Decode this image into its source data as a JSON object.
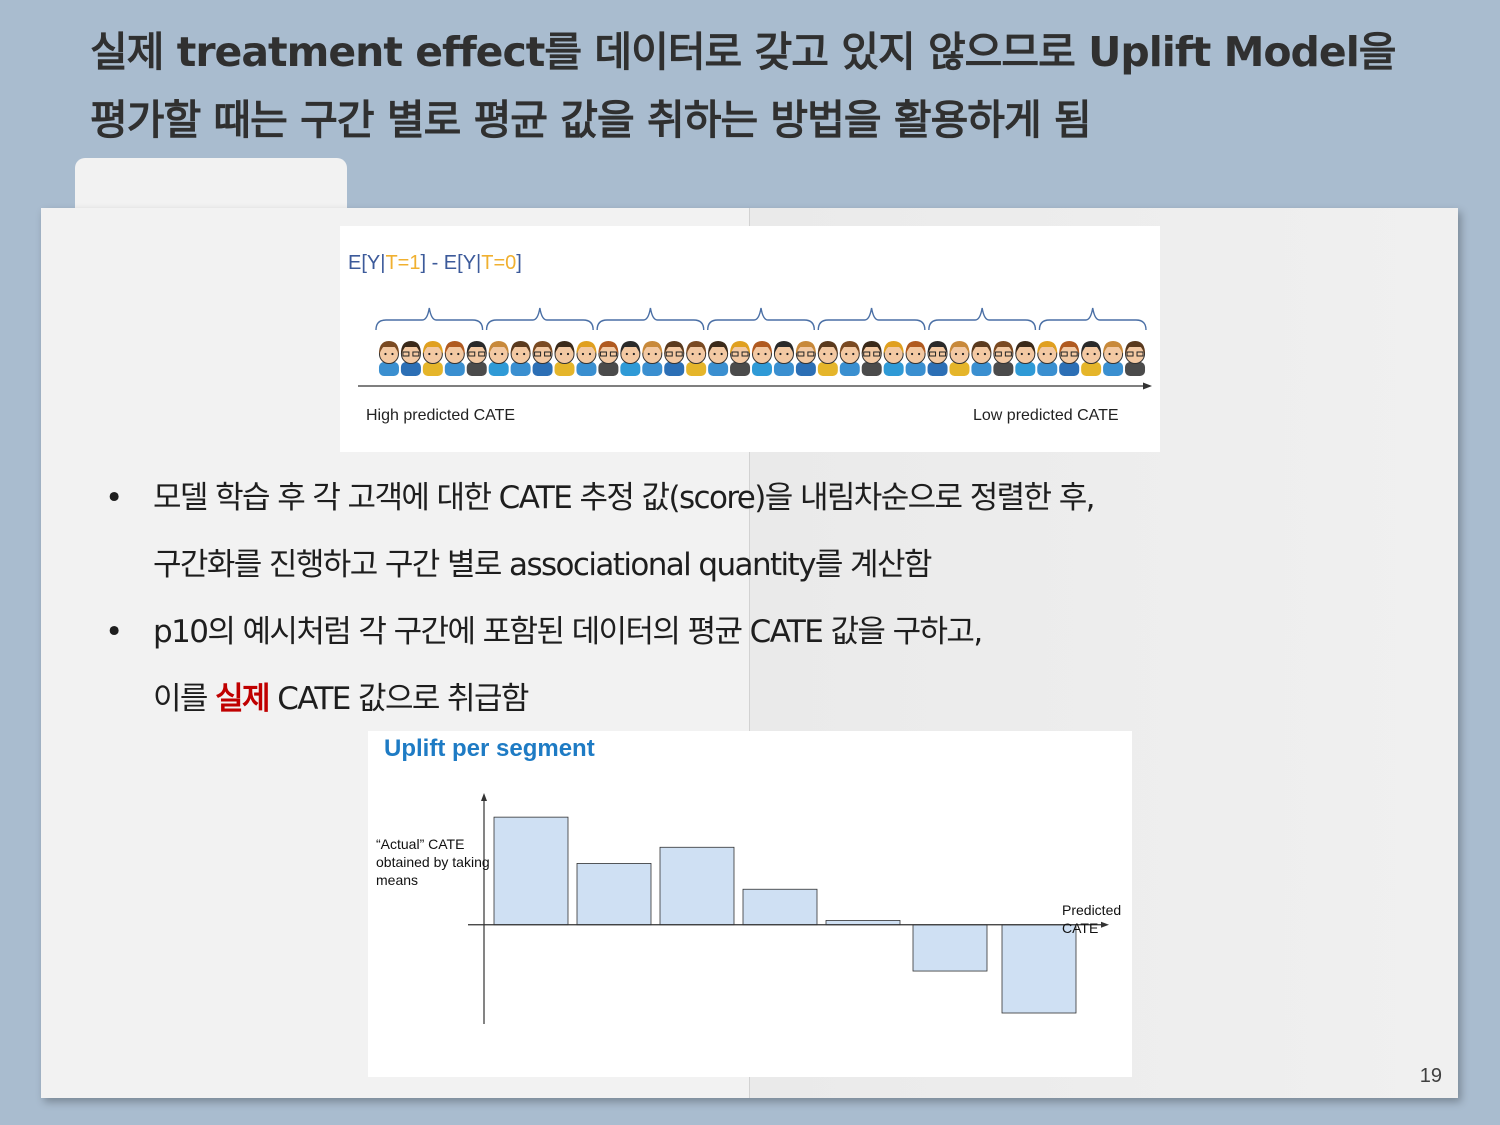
{
  "slide": {
    "title_line1": "실제 treatment effect를 데이터로 갖고 있지 않으므로 Uplift Model을",
    "title_line2": "평가할 때는 구간 별로 평균 값을 취하는 방법을 활용하게 됨",
    "page_number": "19"
  },
  "figure_top": {
    "formula": {
      "p1": "E[Y|",
      "t1": "T=1",
      "p2": "] - E[Y|",
      "t0": "T=0",
      "p3": "]"
    },
    "left_label": "High predicted CATE",
    "right_label": "Low predicted CATE",
    "segments": 7
  },
  "bullets": [
    {
      "line1": "모델 학습 후 각 고객에 대한 CATE 추정 값(score)을 내림차순으로 정렬한 후,",
      "line2": "구간화를 진행하고 구간 별로 associational quantity를 계산함"
    },
    {
      "line1": "p10의 예시처럼 각 구간에 포함된 데이터의 평균 CATE 값을 구하고,",
      "line2_before": "이를 ",
      "line2_highlight": "실제",
      "line2_after": " CATE 값으로 취급함"
    }
  ],
  "chart_data": {
    "type": "bar",
    "title": "Uplift per segment",
    "ylabel": "“Actual” CATE obtained by taking means",
    "xlabel": "Predicted CATE",
    "categories": [
      "",
      "",
      "",
      "",
      "",
      "",
      ""
    ],
    "values": [
      1.0,
      0.57,
      0.72,
      0.33,
      0.04,
      -0.43,
      -0.82
    ],
    "ylim": [
      -0.95,
      1.15
    ],
    "grid": false,
    "bar_color": "#cfe0f3",
    "bar_edge_color": "#333333"
  }
}
